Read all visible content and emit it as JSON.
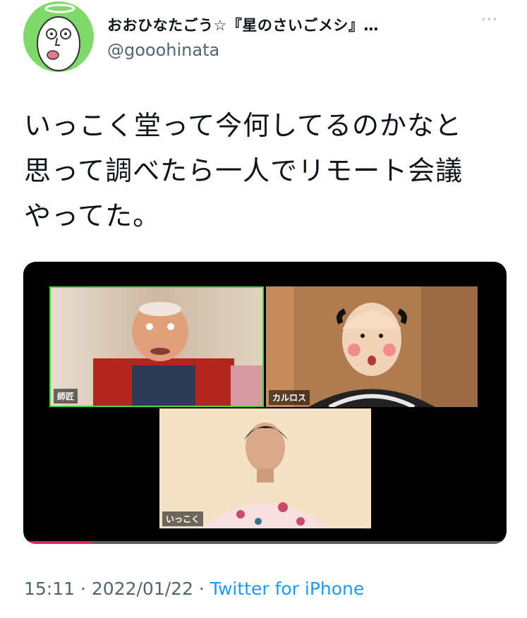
{
  "author": {
    "display_name": "おおひなたごう☆『星のさいごメシ』…",
    "handle": "@gooohinata"
  },
  "tweet": {
    "lines": [
      "いっこく堂って今何してるのかなと",
      "思って調べたら一人でリモート会議",
      "やってた。"
    ]
  },
  "video": {
    "participants": [
      {
        "label": "師匠"
      },
      {
        "label": "カルロス"
      },
      {
        "label": "いっこく"
      }
    ],
    "progress": 0.14,
    "colors": {
      "active_speaker_border": "#4bd63a",
      "progress": "#e0245e"
    }
  },
  "meta": {
    "time": "15:11",
    "date": "2022/01/22",
    "separator": " · ",
    "source": "Twitter for iPhone"
  },
  "icons": {
    "more": "more-horizontal-icon"
  }
}
